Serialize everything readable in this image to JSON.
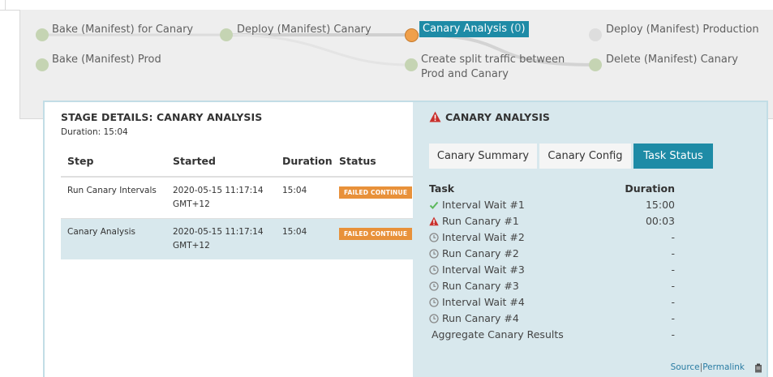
{
  "pipeline": {
    "stages": [
      {
        "name": "Bake (Manifest) for Canary",
        "status": "succeeded"
      },
      {
        "name": "Bake (Manifest) Prod",
        "status": "succeeded"
      },
      {
        "name": "Deploy (Manifest) Canary",
        "status": "succeeded"
      },
      {
        "name": "Canary Analysis",
        "count": "0",
        "status": "running"
      },
      {
        "name_line1": "Create split traffic between",
        "name_line2": "Prod and Canary",
        "status": "succeeded"
      },
      {
        "name": "Deploy (Manifest) Production",
        "status": "not-started"
      },
      {
        "name": "Delete (Manifest) Canary",
        "status": "succeeded"
      }
    ]
  },
  "stage_details": {
    "title": "STAGE DETAILS: CANARY ANALYSIS",
    "duration": "Duration: 15:04",
    "columns": [
      "Step",
      "Started",
      "Duration",
      "Status"
    ],
    "rows": [
      {
        "step": "Run Canary Intervals",
        "started_line1": "2020-05-15 11:17:14",
        "started_line2": "GMT+12",
        "duration": "15:04",
        "status": "FAILED CONTINUE"
      },
      {
        "step": "Canary Analysis",
        "started_line1": "2020-05-15 11:17:14",
        "started_line2": "GMT+12",
        "duration": "15:04",
        "status": "FAILED CONTINUE"
      }
    ]
  },
  "canary_panel": {
    "title": "CANARY ANALYSIS",
    "tabs": [
      "Canary Summary",
      "Canary Config",
      "Task Status"
    ],
    "active_tab": "Task Status",
    "task_header": "Task",
    "duration_header": "Duration",
    "tasks": [
      {
        "name": "Interval Wait #1",
        "icon": "check-icon",
        "duration": "15:00"
      },
      {
        "name": "Run Canary #1",
        "icon": "warning-icon",
        "duration": "00:03"
      },
      {
        "name": "Interval Wait #2",
        "icon": "clock-icon",
        "duration": "-"
      },
      {
        "name": "Run Canary #2",
        "icon": "clock-icon",
        "duration": "-"
      },
      {
        "name": "Interval Wait #3",
        "icon": "clock-icon",
        "duration": "-"
      },
      {
        "name": "Run Canary #3",
        "icon": "clock-icon",
        "duration": "-"
      },
      {
        "name": "Interval Wait #4",
        "icon": "clock-icon",
        "duration": "-"
      },
      {
        "name": "Run Canary #4",
        "icon": "clock-icon",
        "duration": "-"
      },
      {
        "name": "Aggregate Canary Results",
        "icon": "none",
        "duration": "-"
      }
    ],
    "source_link": "Source",
    "separator": "|",
    "permalink": "Permalink"
  },
  "colors": {
    "accent": "#1e8ba6",
    "failed_badge": "#e8913a",
    "succeeded_node": "#c5d4b3",
    "running_node": "#f0a04b",
    "not_started_node": "#dddddd",
    "warning": "#c9302c",
    "check": "#5cb85c"
  }
}
